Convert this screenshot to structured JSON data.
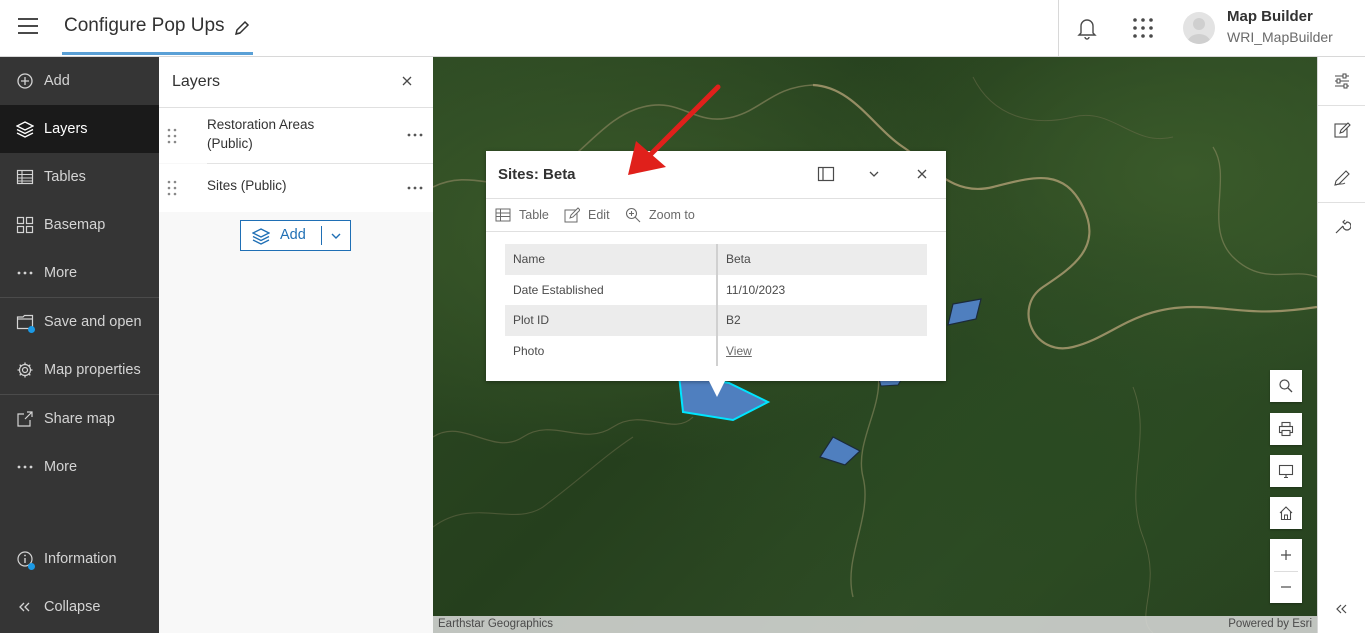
{
  "header": {
    "title": "Configure Pop Ups",
    "user_name": "Map Builder",
    "user_id": "WRI_MapBuilder"
  },
  "leftnav": {
    "items": [
      {
        "label": "Add",
        "icon": "plus-circle-icon"
      },
      {
        "label": "Layers",
        "icon": "layers-icon",
        "active": true
      },
      {
        "label": "Tables",
        "icon": "table-icon"
      },
      {
        "label": "Basemap",
        "icon": "basemap-icon"
      },
      {
        "label": "More",
        "icon": "ellipsis-icon"
      },
      {
        "label": "Save and open",
        "icon": "folder-icon"
      },
      {
        "label": "Map properties",
        "icon": "gear-icon"
      },
      {
        "label": "Share map",
        "icon": "share-icon"
      },
      {
        "label": "More",
        "icon": "ellipsis-icon"
      },
      {
        "label": "Information",
        "icon": "info-icon"
      },
      {
        "label": "Collapse",
        "icon": "chevrons-left-icon"
      }
    ]
  },
  "layers_panel": {
    "title": "Layers",
    "layers": [
      {
        "name_line1": "Restoration Areas",
        "name_line2": "(Public)"
      },
      {
        "name_line1": "Sites (Public)"
      }
    ],
    "add_label": "Add"
  },
  "popup": {
    "title": "Sites: Beta",
    "actions": [
      "Table",
      "Edit",
      "Zoom to"
    ],
    "attributes": [
      {
        "key": "Name",
        "value": "Beta"
      },
      {
        "key": "Date Established",
        "value": "11/10/2023"
      },
      {
        "key": "Plot ID",
        "value": "B2"
      },
      {
        "key": "Photo",
        "value": "View",
        "link": true
      }
    ]
  },
  "map": {
    "attribution_left": "Earthstar Geographics",
    "attribution_right": "Powered by Esri"
  },
  "colors": {
    "nav_bg": "#353535",
    "nav_active": "#1a1a1a",
    "accent_blue": "#1f6fb5",
    "polygon_fill": "#4f7fbf",
    "polygon_selected": "#00e5ff",
    "arrow_red": "#e0201b"
  }
}
